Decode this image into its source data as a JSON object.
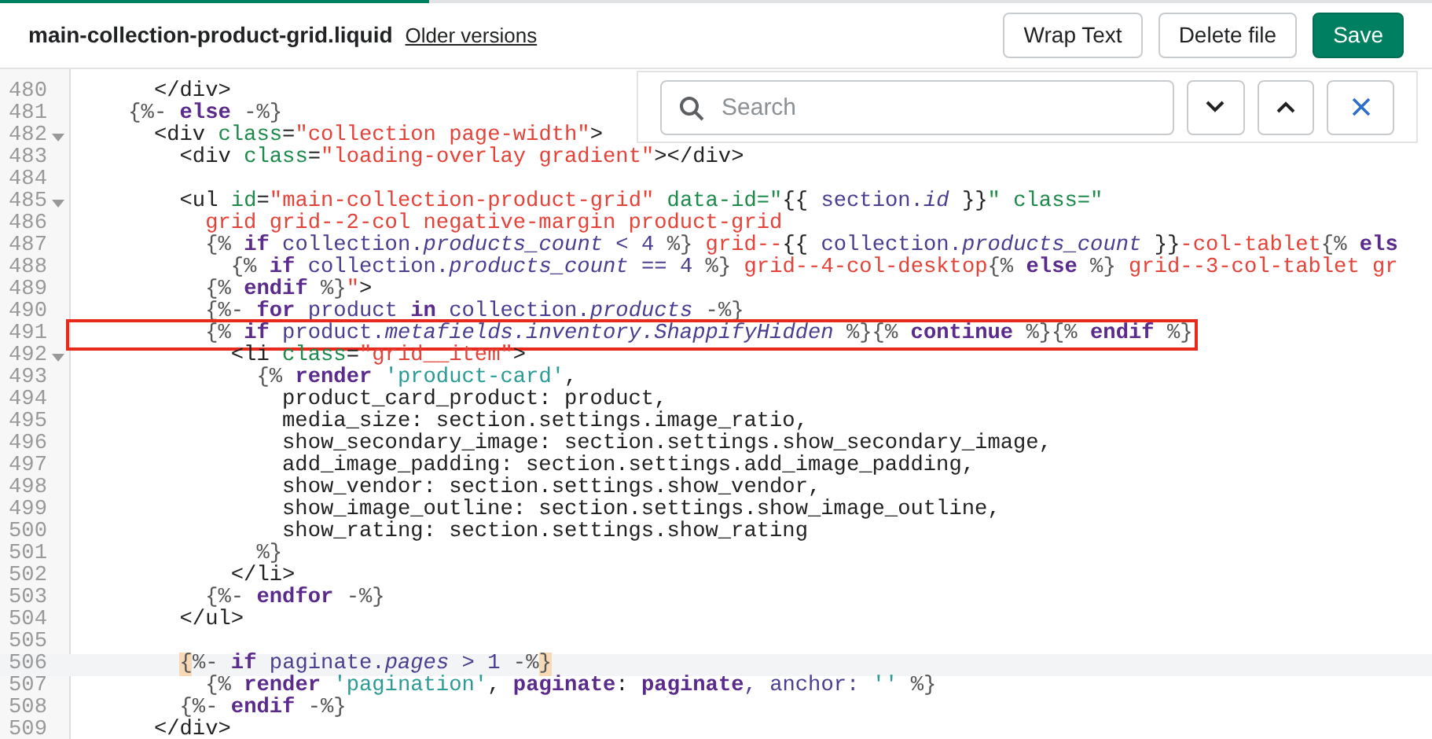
{
  "progress": {
    "level": 0.3
  },
  "file": {
    "name": "main-collection-product-grid.liquid",
    "link": "Older versions"
  },
  "buttons": [
    {
      "label": "Wrap Text",
      "kind": "secondary"
    },
    {
      "label": "Delete file",
      "kind": "secondary"
    },
    {
      "label": "Save",
      "kind": "primary"
    }
  ],
  "search": {
    "placeholder": "Search"
  },
  "lines": [
    {
      "number": "480",
      "fold": false,
      "tokens": [
        {
          "text": "      </div>",
          "kind": "plain"
        }
      ]
    },
    {
      "number": "481",
      "fold": false,
      "tokens": [
        {
          "text": "    {%- ",
          "kind": "delim"
        },
        {
          "text": "else",
          "kind": "keyword"
        },
        {
          "text": " -%}",
          "kind": "delim"
        }
      ]
    },
    {
      "number": "482",
      "fold": true,
      "tokens": [
        {
          "text": "      <div ",
          "kind": "plain"
        },
        {
          "text": "class",
          "kind": "attr"
        },
        {
          "text": "=",
          "kind": "plain"
        },
        {
          "text": "\"collection page-width\"",
          "kind": "string"
        },
        {
          "text": ">",
          "kind": "plain"
        }
      ]
    },
    {
      "number": "483",
      "fold": false,
      "tokens": [
        {
          "text": "        <div ",
          "kind": "plain"
        },
        {
          "text": "class",
          "kind": "attr"
        },
        {
          "text": "=",
          "kind": "plain"
        },
        {
          "text": "\"loading-overlay gradient\"",
          "kind": "string"
        },
        {
          "text": "></div>",
          "kind": "plain"
        }
      ]
    },
    {
      "number": "484",
      "fold": false
    },
    {
      "number": "485",
      "fold": true,
      "tokens": [
        {
          "text": "        <ul ",
          "kind": "plain"
        },
        {
          "text": "id",
          "kind": "attr"
        },
        {
          "text": "=",
          "kind": "plain"
        },
        {
          "text": "\"main-collection-product-grid\" ",
          "kind": "string"
        },
        {
          "text": "data-id=\"",
          "kind": "attr"
        },
        {
          "text": "{{ ",
          "kind": "plain"
        },
        {
          "text": "section.",
          "kind": "variable"
        },
        {
          "text": "id",
          "kind": "property"
        },
        {
          "text": " }}",
          "kind": "plain"
        },
        {
          "text": "\" class=\"",
          "kind": "attr"
        }
      ]
    },
    {
      "number": "486",
      "fold": false,
      "tokens": [
        {
          "text": "          grid grid--2-col negative-margin product-grid",
          "kind": "string"
        }
      ]
    },
    {
      "number": "487",
      "fold": false,
      "tokens": [
        {
          "text": "          {% ",
          "kind": "delim"
        },
        {
          "text": "if",
          "kind": "keyword"
        },
        {
          "text": " collection.",
          "kind": "variable"
        },
        {
          "text": "products_count",
          "kind": "property"
        },
        {
          "text": " < 4 ",
          "kind": "variable"
        },
        {
          "text": "%}",
          "kind": "delim"
        },
        {
          "text": " grid--",
          "kind": "string"
        },
        {
          "text": "{{ ",
          "kind": "plain"
        },
        {
          "text": "collection.",
          "kind": "variable"
        },
        {
          "text": "products_count",
          "kind": "property"
        },
        {
          "text": " }}",
          "kind": "plain"
        },
        {
          "text": "-col-tablet",
          "kind": "string"
        },
        {
          "text": "{% ",
          "kind": "delim"
        },
        {
          "text": "els",
          "kind": "keyword"
        }
      ]
    },
    {
      "number": "488",
      "fold": false,
      "tokens": [
        {
          "text": "            {% ",
          "kind": "delim"
        },
        {
          "text": "if",
          "kind": "keyword"
        },
        {
          "text": " collection.",
          "kind": "variable"
        },
        {
          "text": "products_count",
          "kind": "property"
        },
        {
          "text": " == 4 ",
          "kind": "variable"
        },
        {
          "text": "%}",
          "kind": "delim"
        },
        {
          "text": " grid--4-col-desktop",
          "kind": "string"
        },
        {
          "text": "{% ",
          "kind": "delim"
        },
        {
          "text": "else",
          "kind": "keyword"
        },
        {
          "text": " %}",
          "kind": "delim"
        },
        {
          "text": " grid--3-col-tablet gr",
          "kind": "string"
        }
      ]
    },
    {
      "number": "489",
      "fold": false,
      "tokens": [
        {
          "text": "          {% ",
          "kind": "delim"
        },
        {
          "text": "endif",
          "kind": "keyword"
        },
        {
          "text": " %}",
          "kind": "delim"
        },
        {
          "text": "\"",
          "kind": "string"
        },
        {
          "text": ">",
          "kind": "plain"
        }
      ]
    },
    {
      "number": "490",
      "fold": false,
      "tokens": [
        {
          "text": "          {%- ",
          "kind": "delim"
        },
        {
          "text": "for",
          "kind": "keyword"
        },
        {
          "text": " product ",
          "kind": "variable"
        },
        {
          "text": "in",
          "kind": "keyword"
        },
        {
          "text": " collection.",
          "kind": "variable"
        },
        {
          "text": "products",
          "kind": "property"
        },
        {
          "text": " -%}",
          "kind": "delim"
        }
      ]
    },
    {
      "number": "491",
      "fold": false,
      "boxed": true,
      "tokens": [
        {
          "text": "          {% ",
          "kind": "delim"
        },
        {
          "text": "if",
          "kind": "keyword"
        },
        {
          "text": " product.",
          "kind": "variable"
        },
        {
          "text": "metafields.inventory.ShappifyHidden",
          "kind": "property"
        },
        {
          "text": " %}{% ",
          "kind": "delim"
        },
        {
          "text": "continue",
          "kind": "keyword"
        },
        {
          "text": " %}{% ",
          "kind": "delim"
        },
        {
          "text": "endif",
          "kind": "keyword"
        },
        {
          "text": " %}",
          "kind": "delim"
        }
      ]
    },
    {
      "number": "492",
      "fold": true,
      "tokens": [
        {
          "text": "            <li ",
          "kind": "plain"
        },
        {
          "text": "class",
          "kind": "attr"
        },
        {
          "text": "=",
          "kind": "plain"
        },
        {
          "text": "\"grid__item\"",
          "kind": "string"
        },
        {
          "text": ">",
          "kind": "plain"
        }
      ]
    },
    {
      "number": "493",
      "fold": false,
      "tokens": [
        {
          "text": "              {% ",
          "kind": "delim"
        },
        {
          "text": "render",
          "kind": "keyword"
        },
        {
          "text": " 'product-card'",
          "kind": "quoted"
        },
        {
          "text": ",",
          "kind": "plain"
        }
      ]
    },
    {
      "number": "494",
      "fold": false,
      "tokens": [
        {
          "text": "                product_card_product: product,",
          "kind": "plain"
        }
      ]
    },
    {
      "number": "495",
      "fold": false,
      "tokens": [
        {
          "text": "                media_size: section.settings.image_ratio,",
          "kind": "plain"
        }
      ]
    },
    {
      "number": "496",
      "fold": false,
      "tokens": [
        {
          "text": "                show_secondary_image: section.settings.show_secondary_image,",
          "kind": "plain"
        }
      ]
    },
    {
      "number": "497",
      "fold": false,
      "tokens": [
        {
          "text": "                add_image_padding: section.settings.add_image_padding,",
          "kind": "plain"
        }
      ]
    },
    {
      "number": "498",
      "fold": false,
      "tokens": [
        {
          "text": "                show_vendor: section.settings.show_vendor,",
          "kind": "plain"
        }
      ]
    },
    {
      "number": "499",
      "fold": false,
      "tokens": [
        {
          "text": "                show_image_outline: section.settings.show_image_outline,",
          "kind": "plain"
        }
      ]
    },
    {
      "number": "500",
      "fold": false,
      "tokens": [
        {
          "text": "                show_rating: section.settings.show_rating",
          "kind": "plain"
        }
      ]
    },
    {
      "number": "501",
      "fold": false,
      "tokens": [
        {
          "text": "              %}",
          "kind": "delim"
        }
      ]
    },
    {
      "number": "502",
      "fold": false,
      "tokens": [
        {
          "text": "            </li>",
          "kind": "plain"
        }
      ]
    },
    {
      "number": "503",
      "fold": false,
      "tokens": [
        {
          "text": "          {%- ",
          "kind": "delim"
        },
        {
          "text": "endfor",
          "kind": "keyword"
        },
        {
          "text": " -%}",
          "kind": "delim"
        }
      ]
    },
    {
      "number": "504",
      "fold": false,
      "tokens": [
        {
          "text": "        </ul>",
          "kind": "plain"
        }
      ]
    },
    {
      "number": "505",
      "fold": false
    },
    {
      "number": "506",
      "fold": false,
      "active": true,
      "tokens": [
        {
          "text": "        {",
          "kind": "bracket"
        },
        {
          "text": "%- ",
          "kind": "delim"
        },
        {
          "text": "if",
          "kind": "keyword"
        },
        {
          "text": " paginate.",
          "kind": "variable"
        },
        {
          "text": "pages",
          "kind": "property"
        },
        {
          "text": " > 1 ",
          "kind": "variable"
        },
        {
          "text": "-%",
          "kind": "delim"
        },
        {
          "text": "}",
          "kind": "bracket"
        }
      ]
    },
    {
      "number": "507",
      "fold": false,
      "tokens": [
        {
          "text": "          {% ",
          "kind": "delim"
        },
        {
          "text": "render",
          "kind": "keyword"
        },
        {
          "text": " 'pagination'",
          "kind": "quoted"
        },
        {
          "text": ", ",
          "kind": "plain"
        },
        {
          "text": "paginate",
          "kind": "keyword"
        },
        {
          "text": ": ",
          "kind": "plain"
        },
        {
          "text": "paginate",
          "kind": "keyword"
        },
        {
          "text": ", anchor: ",
          "kind": "variable"
        },
        {
          "text": "''",
          "kind": "quoted"
        },
        {
          "text": " %}",
          "kind": "delim"
        }
      ]
    },
    {
      "number": "508",
      "fold": false,
      "tokens": [
        {
          "text": "        {%- ",
          "kind": "delim"
        },
        {
          "text": "endif",
          "kind": "keyword"
        },
        {
          "text": " -%}",
          "kind": "delim"
        }
      ]
    },
    {
      "number": "509",
      "fold": false,
      "tokens": [
        {
          "text": "      </div>",
          "kind": "plain"
        }
      ]
    }
  ]
}
